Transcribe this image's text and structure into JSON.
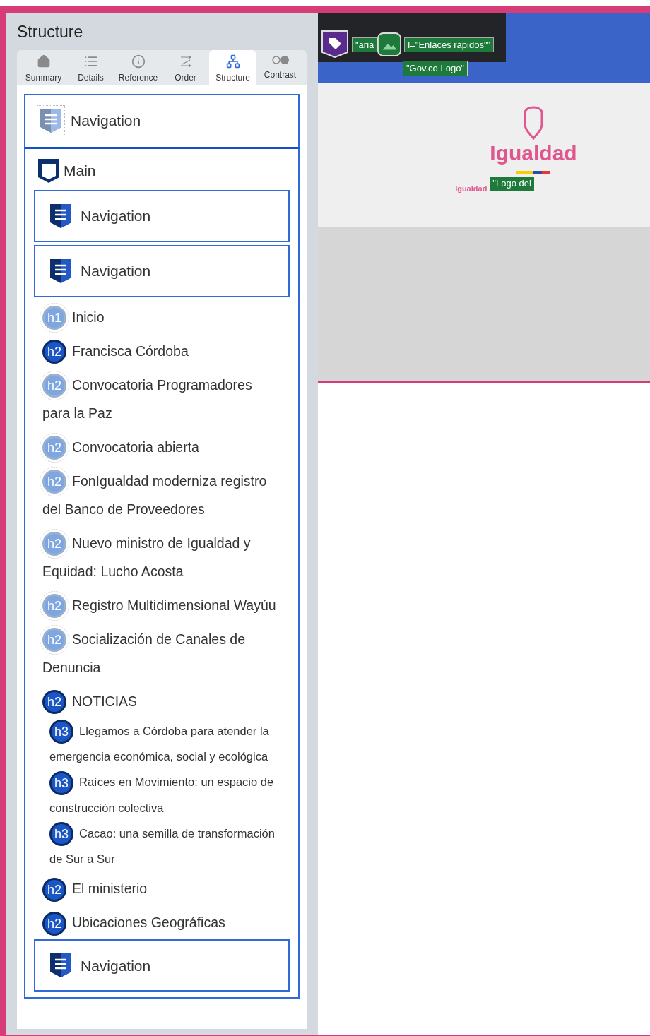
{
  "panel": {
    "title": "Structure",
    "tabs": [
      {
        "label": "Summary",
        "selected": false
      },
      {
        "label": "Details",
        "selected": false
      },
      {
        "label": "Reference",
        "selected": false
      },
      {
        "label": "Order",
        "selected": false
      },
      {
        "label": "Structure",
        "selected": true
      },
      {
        "label": "Contrast",
        "selected": false
      }
    ],
    "tree": [
      {
        "kind": "navigation",
        "label": "Navigation",
        "dimmed": true
      },
      {
        "kind": "main",
        "label": "Main",
        "children": [
          {
            "kind": "navigation",
            "label": "Navigation",
            "dimmed": false
          },
          {
            "kind": "navigation",
            "label": "Navigation",
            "dimmed": false
          },
          {
            "kind": "heading",
            "badge": "h1",
            "label": "Inicio",
            "dimmed": true
          },
          {
            "kind": "heading",
            "badge": "h2",
            "label": "Francisca Córdoba",
            "dimmed": false
          },
          {
            "kind": "heading",
            "badge": "h2",
            "label": "Convocatoria Programadores para la Paz",
            "dimmed": true
          },
          {
            "kind": "heading",
            "badge": "h2",
            "label": "Convocatoria abierta",
            "dimmed": true
          },
          {
            "kind": "heading",
            "badge": "h2",
            "label": "FonIgualdad moderniza registro del Banco de Proveedores",
            "dimmed": true
          },
          {
            "kind": "heading",
            "badge": "h2",
            "label": "Nuevo ministro de Igualdad y Equidad: Lucho Acosta",
            "dimmed": true
          },
          {
            "kind": "heading",
            "badge": "h2",
            "label": "Registro Multidimensional Wayúu",
            "dimmed": true
          },
          {
            "kind": "heading",
            "badge": "h2",
            "label": "Socialización de Canales de Denuncia",
            "dimmed": true
          },
          {
            "kind": "heading",
            "badge": "h2",
            "label": "NOTICIAS",
            "dimmed": false,
            "children": [
              {
                "kind": "heading",
                "badge": "h3",
                "label": "Llegamos a Córdoba para atender la emergencia económica, social y ecológica",
                "dimmed": false
              },
              {
                "kind": "heading",
                "badge": "h3",
                "label": "Raíces en Movimiento: un espacio de construcción colectiva",
                "dimmed": false
              },
              {
                "kind": "heading",
                "badge": "h3",
                "label": "Cacao: una semilla de transformación de Sur a Sur",
                "dimmed": false
              }
            ]
          },
          {
            "kind": "heading",
            "badge": "h2",
            "label": "El ministerio",
            "dimmed": false
          },
          {
            "kind": "heading",
            "badge": "h2",
            "label": "Ubicaciones Geográficas",
            "dimmed": false
          },
          {
            "kind": "navigation",
            "label": "Navigation",
            "dimmed": false
          }
        ]
      }
    ]
  },
  "preview": {
    "labels": [
      "\"aria",
      "l=\"Enlaces rápidos\"\"",
      "\"Gov.co Logo\""
    ],
    "logo": "Igualdad",
    "small_logo": "Igualdad",
    "logo_label": "\"Logo del"
  }
}
